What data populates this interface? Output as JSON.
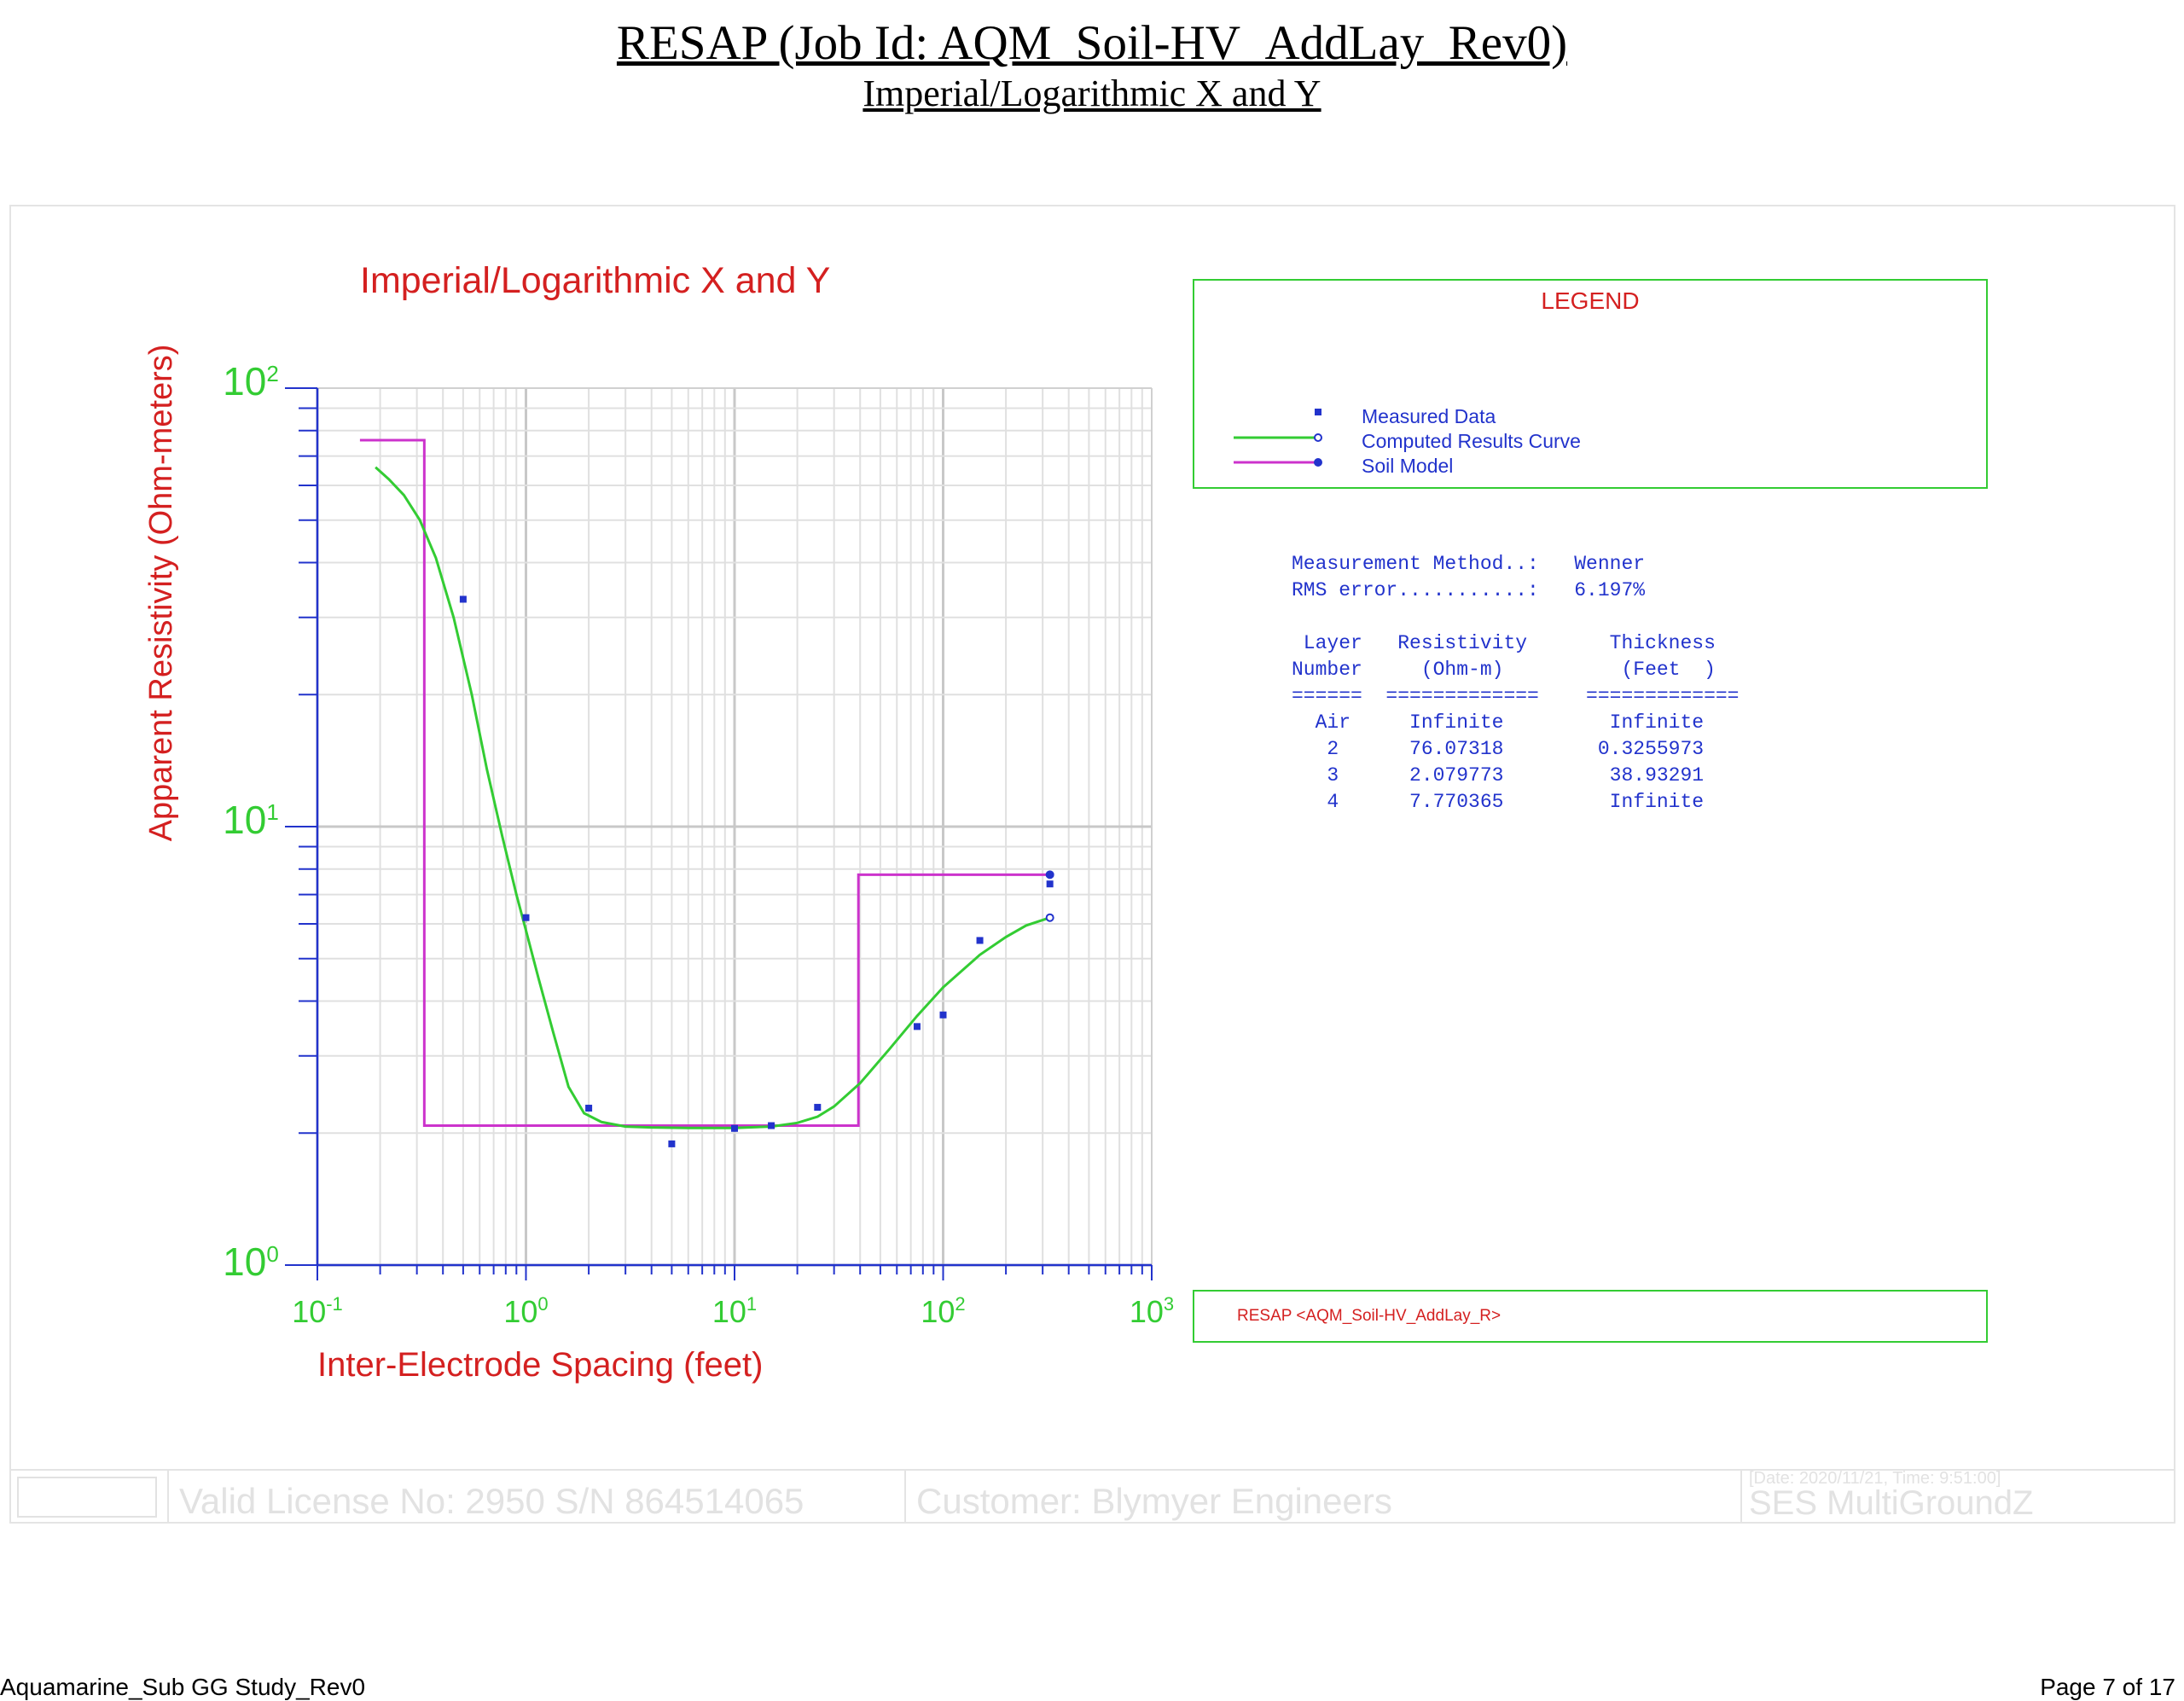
{
  "header": {
    "title": "RESAP (Job Id: AQM_Soil-HV_AddLay_Rev0)",
    "subtitle": "Imperial/Logarithmic X and Y"
  },
  "chart_data": {
    "type": "line",
    "title": "Imperial/Logarithmic X and Y",
    "xlabel": "Inter-Electrode Spacing (feet)",
    "ylabel": "Apparent Resistivity (Ohm-meters)",
    "x_scale": "log",
    "y_scale": "log",
    "xlim": [
      0.1,
      1000
    ],
    "ylim": [
      1,
      100
    ],
    "x_ticks": [
      {
        "base": "10",
        "exp": "-1"
      },
      {
        "base": "10",
        "exp": "0"
      },
      {
        "base": "10",
        "exp": "1"
      },
      {
        "base": "10",
        "exp": "2"
      },
      {
        "base": "10",
        "exp": "3"
      }
    ],
    "y_ticks": [
      {
        "base": "10",
        "exp": "0"
      },
      {
        "base": "10",
        "exp": "1"
      },
      {
        "base": "10",
        "exp": "2"
      }
    ],
    "grid": true,
    "legend_placement": "right",
    "series": [
      {
        "name": "Measured Data",
        "kind": "scatter",
        "color": "#2233cc",
        "x": [
          0.5,
          1,
          2,
          5,
          10,
          15,
          25,
          75,
          100,
          150,
          325
        ],
        "y": [
          33,
          6.2,
          2.28,
          1.89,
          2.05,
          2.08,
          2.29,
          3.5,
          3.72,
          5.5,
          7.4
        ]
      },
      {
        "name": "Computed Results Curve",
        "kind": "line",
        "color": "#33cc33",
        "x": [
          0.19,
          0.22,
          0.26,
          0.31,
          0.37,
          0.45,
          0.55,
          0.65,
          0.77,
          0.9,
          1.0,
          1.15,
          1.35,
          1.6,
          1.9,
          2.3,
          3,
          4,
          6,
          10,
          15,
          20,
          25,
          30,
          40,
          55,
          75,
          100,
          150,
          200,
          250,
          325
        ],
        "y": [
          66,
          62,
          57,
          50,
          41,
          30,
          20,
          13.5,
          9.5,
          7,
          5.8,
          4.5,
          3.4,
          2.55,
          2.22,
          2.12,
          2.07,
          2.06,
          2.055,
          2.055,
          2.07,
          2.11,
          2.18,
          2.3,
          2.6,
          3.1,
          3.7,
          4.3,
          5.1,
          5.6,
          5.95,
          6.2
        ]
      },
      {
        "name": "Soil Model",
        "kind": "step",
        "color": "#cc33cc",
        "x": [
          0.16,
          0.3255973,
          0.3255973,
          39.2588,
          39.2588,
          325
        ],
        "y": [
          76.07318,
          76.07318,
          2.079773,
          2.079773,
          7.770365,
          7.770365
        ]
      }
    ]
  },
  "legend": {
    "title": "LEGEND",
    "items": [
      "Measured Data",
      "Computed Results Curve",
      "Soil Model"
    ]
  },
  "info": {
    "method_line": "Measurement Method..:   Wenner",
    "rms_line": "RMS error...........:   6.197%",
    "table_header1": " Layer   Resistivity       Thickness",
    "table_header2": "Number     (Ohm-m)          (Feet  )",
    "table_rule": "======  =============    =============",
    "rows": [
      "  Air     Infinite         Infinite",
      "   2      76.07318        0.3255973",
      "   3      2.079773         38.93291",
      "   4      7.770365         Infinite"
    ]
  },
  "reference": "RESAP <AQM_Soil-HV_AddLay_R>",
  "footer": {
    "license": "Valid License No: 2950 S/N 864514065",
    "customer": "Customer: Blymyer Engineers",
    "date": "[Date: 2020/11/21, Time:  9:51:00]",
    "product": "SES MultiGroundZ"
  },
  "page": {
    "doc_name": "Aquamarine_Sub GG Study_Rev0",
    "page_number": "Page 7 of 17"
  }
}
